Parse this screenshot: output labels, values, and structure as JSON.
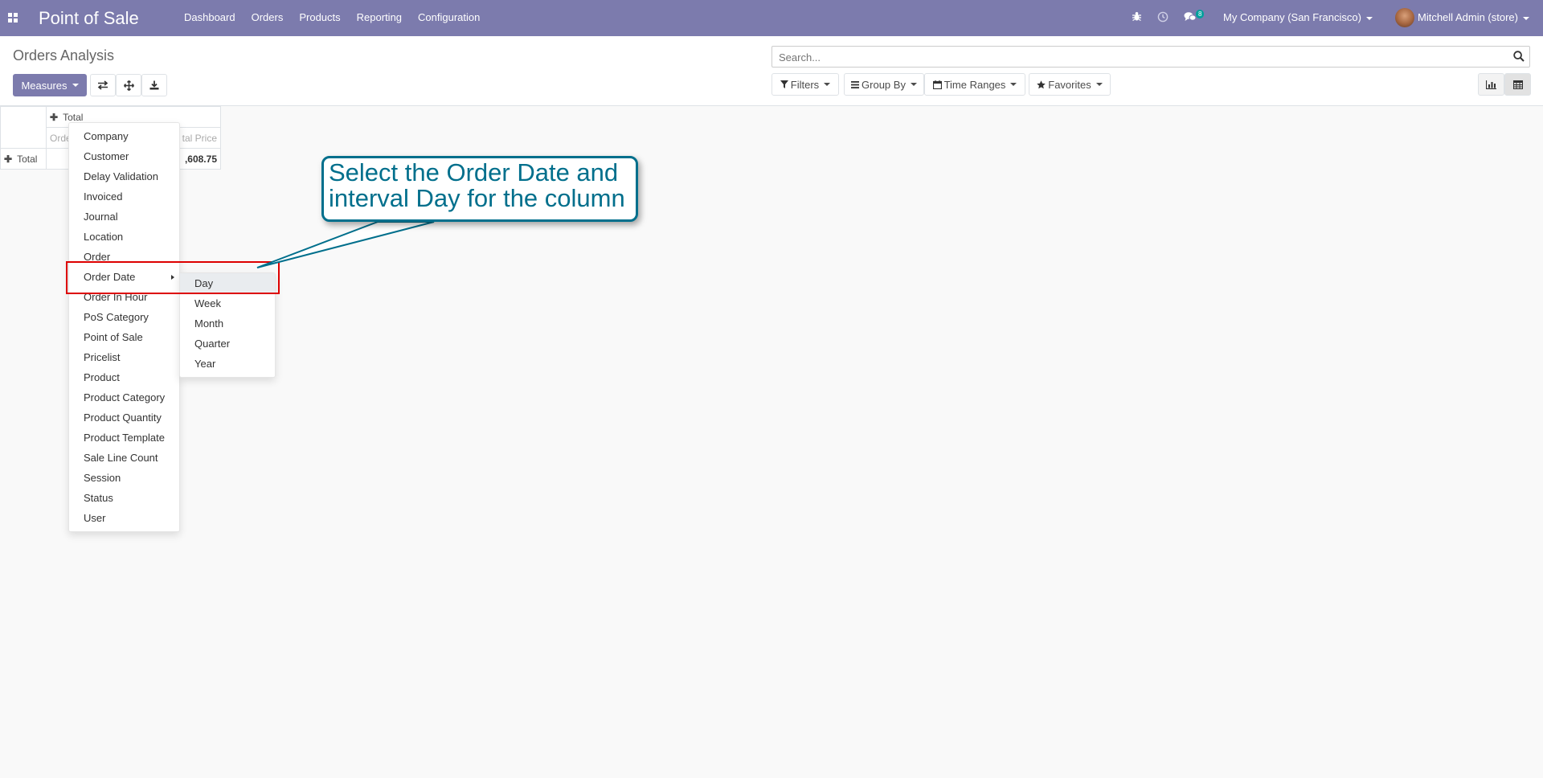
{
  "navbar": {
    "brand": "Point of Sale",
    "menu": [
      "Dashboard",
      "Orders",
      "Products",
      "Reporting",
      "Configuration"
    ],
    "messages_badge": "8",
    "company": "My Company (San Francisco)",
    "user": "Mitchell Admin (store)",
    "bg_color": "#7c7bad"
  },
  "control_panel": {
    "title": "Orders Analysis",
    "measures_label": "Measures",
    "search_placeholder": "Search...",
    "filters_label": "Filters",
    "groupby_label": "Group By",
    "timeranges_label": "Time Ranges",
    "favorites_label": "Favorites"
  },
  "pivot": {
    "header_total": "Total",
    "col_measure_1": "Orde",
    "col_measure_2": "tal Price",
    "row_total": "Total",
    "row_value": ",608.75"
  },
  "groupby_menu": {
    "items": [
      "Company",
      "Customer",
      "Delay Validation",
      "Invoiced",
      "Journal",
      "Location",
      "Order",
      "Order Date",
      "Order In Hour",
      "PoS Category",
      "Point of Sale",
      "Pricelist",
      "Product",
      "Product Category",
      "Product Quantity",
      "Product Template",
      "Sale Line Count",
      "Session",
      "Status",
      "User"
    ],
    "submenu": [
      "Day",
      "Week",
      "Month",
      "Quarter",
      "Year"
    ]
  },
  "callout": {
    "line1": "Select the Order Date and",
    "line2": "interval Day for the column"
  }
}
